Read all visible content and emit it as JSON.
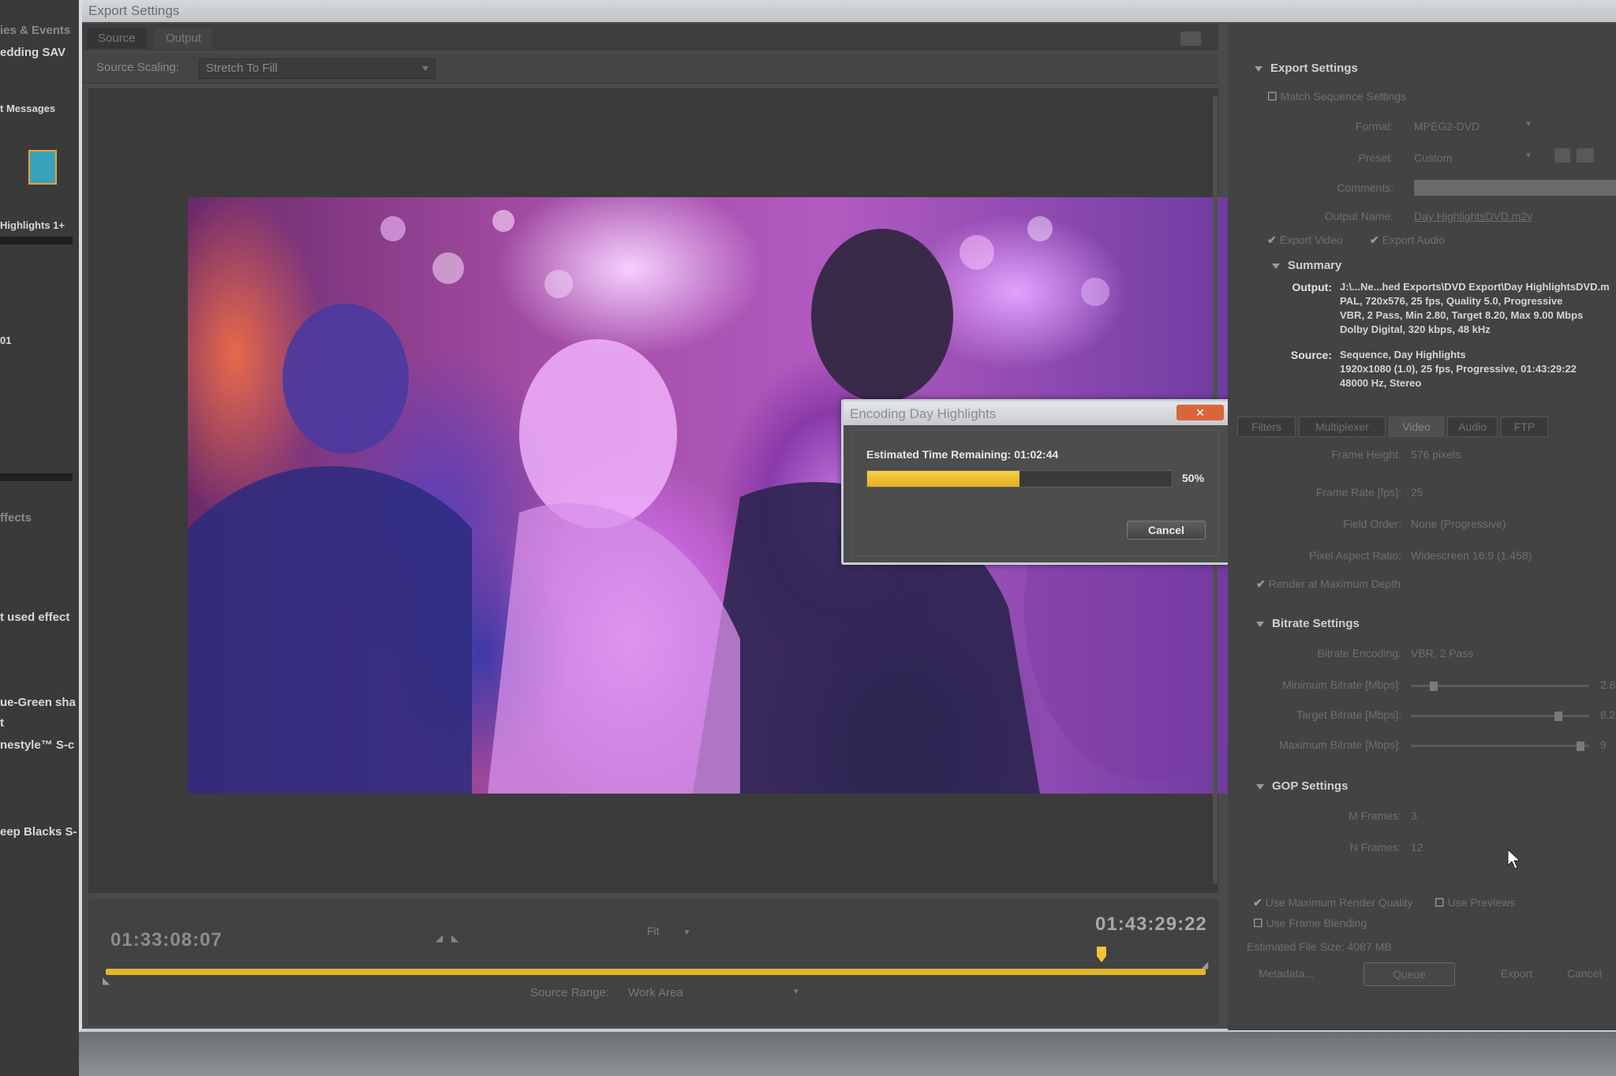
{
  "window": {
    "title": "Export Settings"
  },
  "tabs": [
    "Source",
    "Output"
  ],
  "source_scaling": {
    "label": "Source Scaling:",
    "value": "Stretch To Fill"
  },
  "background_app": {
    "lines": [
      "ies & Events",
      "edding SAV",
      "t Messages",
      "Highlights 1+",
      "01",
      "ffects",
      "t used effect",
      "ue-Green sha",
      "t",
      "nestyle™ S-c",
      "eep Blacks S-"
    ]
  },
  "dialog": {
    "title": "Encoding Day Highlights",
    "estimated_label": "Estimated Time Remaining: 01:02:44",
    "progress": 0.5,
    "progress_text": "50%",
    "cancel_label": "Cancel"
  },
  "timeline": {
    "current_tc": "01:33:08:07",
    "duration_tc": "01:43:29:22",
    "fit_label": "Fit",
    "source_range_label": "Source Range:",
    "source_range_value": "Work Area"
  },
  "export_settings": {
    "header": "Export Settings",
    "match_sequence": "Match Sequence Settings",
    "format_label": "Format:",
    "format_value": "MPEG2-DVD",
    "preset_label": "Preset:",
    "preset_value": "Custom",
    "comments_label": "Comments:",
    "output_name_label": "Output Name:",
    "output_name_value": "Day HighlightsDVD.m2v",
    "export_video": "Export Video",
    "export_audio": "Export Audio"
  },
  "summary": {
    "header": "Summary",
    "output_label": "Output:",
    "output_lines": [
      "J:\\...Ne...hed Exports\\DVD Export\\Day HighlightsDVD.m",
      "PAL, 720x576, 25 fps, Quality 5.0, Progressive",
      "VBR, 2 Pass, Min 2.80, Target 8.20, Max 9.00 Mbps",
      "Dolby Digital, 320 kbps, 48 kHz"
    ],
    "source_label": "Source:",
    "source_lines": [
      "Sequence, Day Highlights",
      "1920x1080 (1.0), 25 fps, Progressive, 01:43:29:22",
      "48000 Hz, Stereo"
    ]
  },
  "panel_tabs": [
    "Filters",
    "Multiplexer",
    "Video",
    "Audio",
    "FTP"
  ],
  "video_settings": {
    "frame_height_label": "Frame Height:",
    "frame_height_value": "576 pixels",
    "frame_rate_label": "Frame Rate [fps]:",
    "frame_rate_value": "25",
    "field_order_label": "Field Order:",
    "field_order_value": "None (Progressive)",
    "pixel_aspect_label": "Pixel Aspect Ratio:",
    "pixel_aspect_value": "Widescreen 16:9 (1.458)",
    "render_max_depth": "Render at Maximum Depth"
  },
  "bitrate": {
    "header": "Bitrate Settings",
    "encoding_label": "Bitrate Encoding:",
    "encoding_value": "VBR, 2 Pass",
    "min_label": "Minimum Bitrate [Mbps]:",
    "min_value": "2.8",
    "target_label": "Target Bitrate [Mbps]:",
    "target_value": "8.2",
    "max_label": "Maximum Bitrate [Mbps]:",
    "max_value": "9"
  },
  "gop": {
    "header": "GOP Settings",
    "m_label": "M Frames:",
    "m_value": "3",
    "n_label": "N Frames:",
    "n_value": "12"
  },
  "render": {
    "use_max_quality": "Use Maximum Render Quality",
    "use_previews": "Use Previews",
    "use_frame_blending": "Use Frame Blending",
    "file_size": "Estimated File Size: 4087 MB"
  },
  "buttons": {
    "metadata": "Metadata...",
    "queue": "Queue",
    "export": "Export",
    "cancel": "Cancel"
  },
  "colors": {
    "accent": "#e2b12a",
    "panel": "#434343",
    "dialog_close": "#d9663a"
  }
}
